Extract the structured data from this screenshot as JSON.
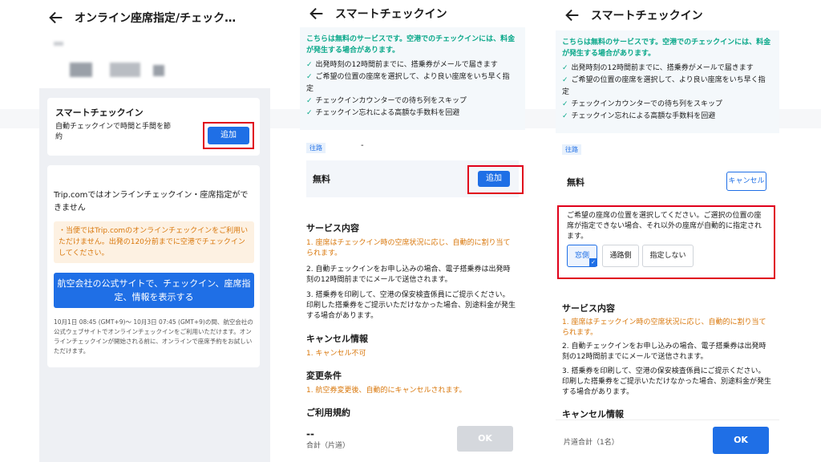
{
  "panel1": {
    "header_title": "オンライン座席指定/チェック…",
    "smart_title": "スマートチェックイン",
    "smart_desc": "自動チェックインで時間と手間を節約",
    "add_label": "追加",
    "info_title": "Trip.comではオンラインチェックイン・座席指定ができません",
    "notice": "・当便ではTrip.comのオンラインチェックインをご利用いただけません。出発の120分前までに空港でチェックインしてください。",
    "airline_btn": "航空会社の公式サイトで、チェックイン、座席指定、情報を表示する",
    "footnote": "10月1日 08:45 (GMT+9)〜 10月3日 07:45 (GMT+9)の間、航空会社の公式ウェブサイトでオンラインチェックインをご利用いただけます。オンラインチェックインが開始される前に、オンラインで座席予約をお試しいただけます。"
  },
  "panel2": {
    "header_title": "スマートチェックイン",
    "intro": "こちらは無料のサービスです。空港でのチェックインには、料金が発生する場合があります。",
    "benefits": [
      "出発時刻の12時間前までに、搭乗券がメールで届きます",
      "ご希望の位置の座席を選択して、より良い座席をいち早く指定",
      "チェックインカウンターでの待ち列をスキップ",
      "チェックイン忘れによる高額な手数料を回避"
    ],
    "route_tag": "往路",
    "route_dash": "-",
    "free_label": "無料",
    "add_label": "追加",
    "service_title": "サービス内容",
    "service_items": [
      "1. 座席はチェックイン時の空席状況に応じ、自動的に割り当てられます。",
      "2. 自動チェックインをお申し込みの場合、電子搭乗券は出発時刻の12時間前までにメールで送信されます。",
      "3. 搭乗券を印刷して、空港の保安検査係員にご提示ください。印刷した搭乗券をご提示いただけなかった場合、別途料金が発生する場合があります。"
    ],
    "cancel_title": "キャンセル情報",
    "cancel_item": "1. キャンセル不可",
    "change_title": "変更条件",
    "change_item": "1. 航空券変更後、自動的にキャンセルされます。",
    "terms_title": "ご利用規約",
    "price": "--",
    "total_label": "合計（片道）",
    "ok_label": "OK"
  },
  "panel3": {
    "header_title": "スマートチェックイン",
    "intro": "こちらは無料のサービスです。空港でのチェックインには、料金が発生する場合があります。",
    "benefits": [
      "出発時刻の12時間前までに、搭乗券がメールで届きます",
      "ご希望の位置の座席を選択して、より良い座席をいち早く指定",
      "チェックインカウンターでの待ち列をスキップ",
      "チェックイン忘れによる高額な手数料を回避"
    ],
    "route_tag": "往路",
    "free_label": "無料",
    "cancel_label": "キャンセル",
    "seat_prompt": "ご希望の座席の位置を選択してください。ご選択の位置の座席が指定できない場合、それ以外の座席が自動的に指定されます。",
    "seat_options": [
      "窓側",
      "通路側",
      "指定しない"
    ],
    "service_title": "サービス内容",
    "service_items": [
      "1. 座席はチェックイン時の空席状況に応じ、自動的に割り当てられます。",
      "2. 自動チェックインをお申し込みの場合、電子搭乗券は出発時刻の12時間前までにメールで送信されます。",
      "3. 搭乗券を印刷して、空港の保安検査係員にご提示ください。印刷した搭乗券をご提示いただけなかった場合、別途料金が発生する場合があります。"
    ],
    "cancel_title": "キャンセル情報",
    "total_label": "片道合計（1名）",
    "ok_label": "OK"
  },
  "colors": {
    "primary": "#1f6fe6",
    "highlight": "#e0001b",
    "teal": "#0aa88a",
    "orange": "#d9770b"
  }
}
